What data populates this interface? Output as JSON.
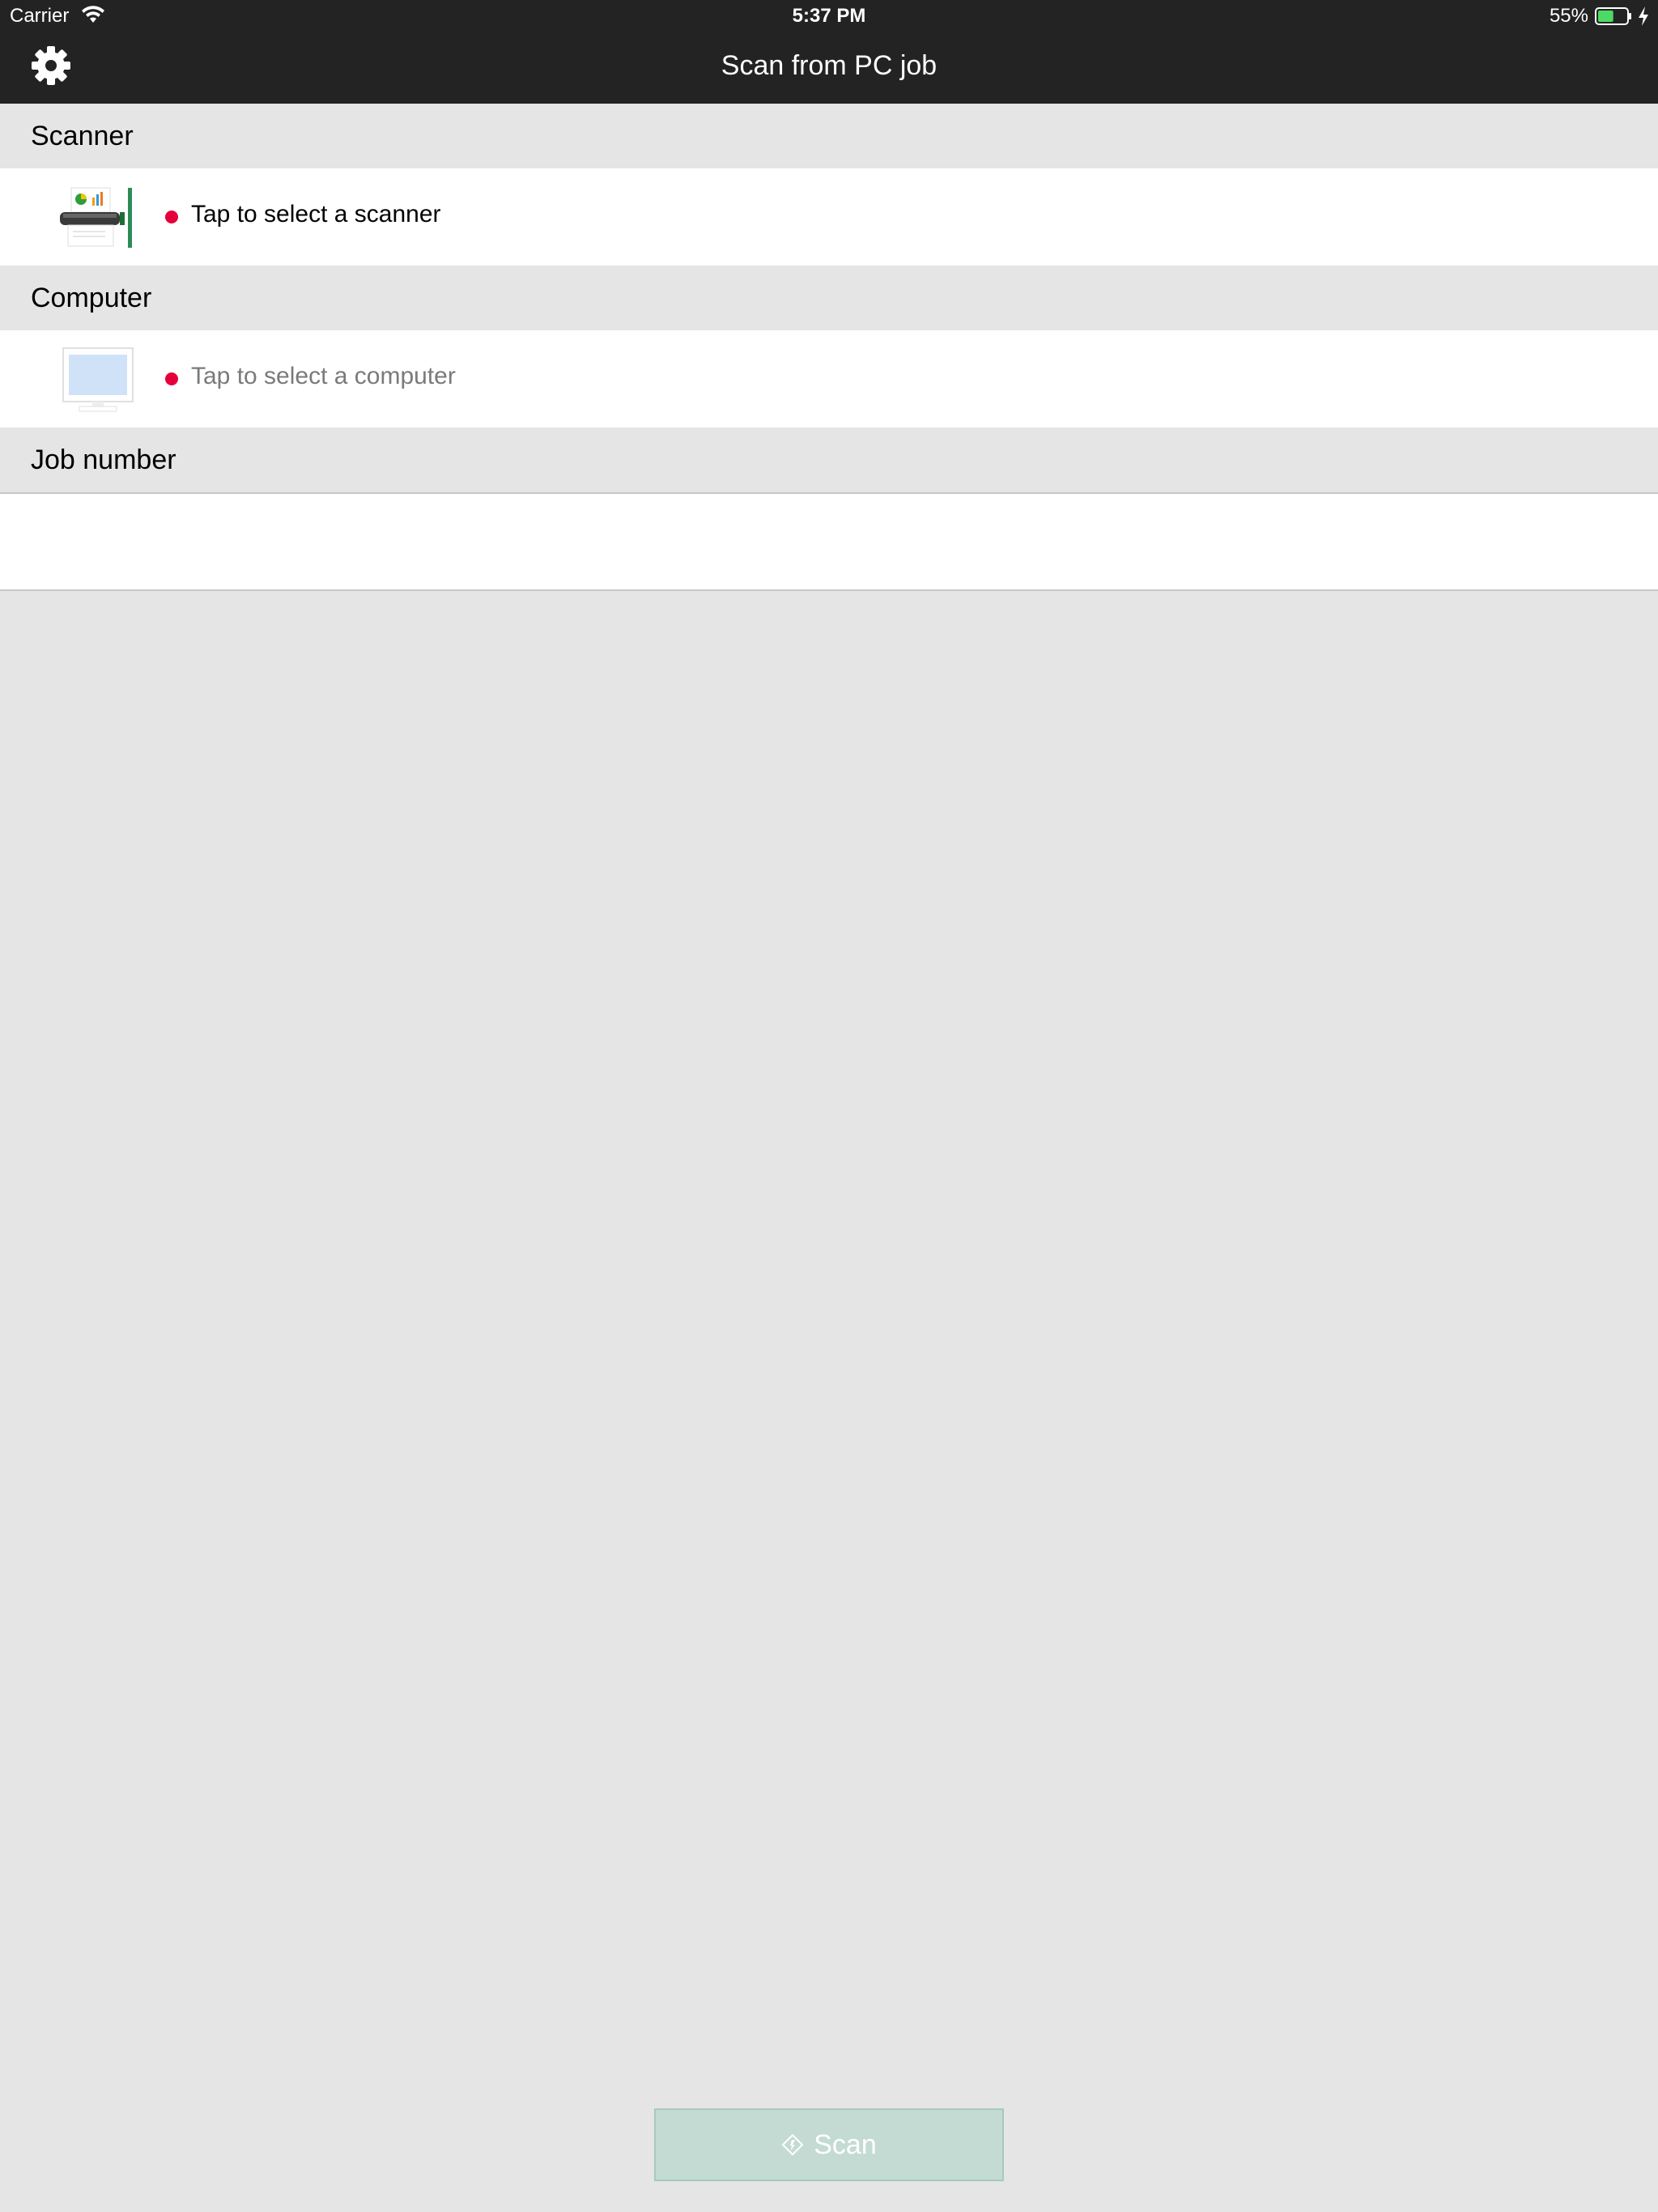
{
  "status_bar": {
    "carrier": "Carrier",
    "time": "5:37 PM",
    "battery_percent": "55%",
    "battery_level": 0.55
  },
  "nav": {
    "title": "Scan from PC job",
    "settings_icon": "gear-icon"
  },
  "sections": {
    "scanner": {
      "header": "Scanner",
      "row_label": "Tap to select a scanner",
      "status_color": "#e5003b"
    },
    "computer": {
      "header": "Computer",
      "row_label": "Tap to select a computer",
      "status_color": "#e5003b"
    },
    "job_number": {
      "header": "Job number",
      "value": ""
    }
  },
  "scan_button": {
    "label": "Scan",
    "icon": "scan-diamond-icon",
    "color": "#c4dbd3"
  }
}
